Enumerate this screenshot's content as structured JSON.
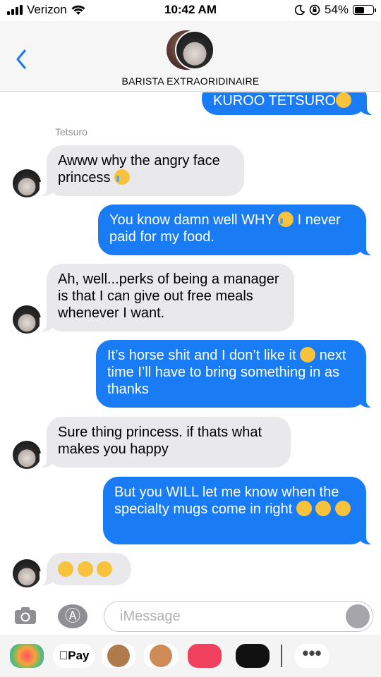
{
  "status_bar": {
    "carrier": "Verizon",
    "time": "10:42 AM",
    "battery": "54%",
    "battery_level": 0.54
  },
  "header": {
    "contact_name": "BARISTA EXTRAORIDINAIRE"
  },
  "conversation": {
    "sender_label": "Tetsuro",
    "messages": [
      {
        "from": "me",
        "text": "KUROO TETSURO",
        "emoji": "huffing-face"
      },
      {
        "from": "them",
        "text": "Awww why the angry face princess",
        "emoji": "crying-face"
      },
      {
        "from": "me",
        "text": "You know damn well WHY",
        "text2": "I never paid for my food.",
        "emoji": "loudly-crying-face"
      },
      {
        "from": "them",
        "text": "Ah, well...perks of being a manager is that I can give out free meals whenever I want."
      },
      {
        "from": "me",
        "text": "It’s horse shit and I don’t like it",
        "text2": "next time I’ll have to bring something in as thanks",
        "emoji": "huffing-face"
      },
      {
        "from": "them",
        "text": "Sure thing princess. if thats what makes you happy"
      },
      {
        "from": "me",
        "text": "But you WILL let me know when the specialty mugs come in right",
        "emoji": "pleading-face"
      },
      {
        "from": "them",
        "text": "",
        "emoji": "tears-of-joy-face"
      }
    ]
  },
  "input": {
    "placeholder": "iMessage"
  },
  "app_drawer": {
    "pay_label": "Pay",
    "more_label": "•••"
  }
}
